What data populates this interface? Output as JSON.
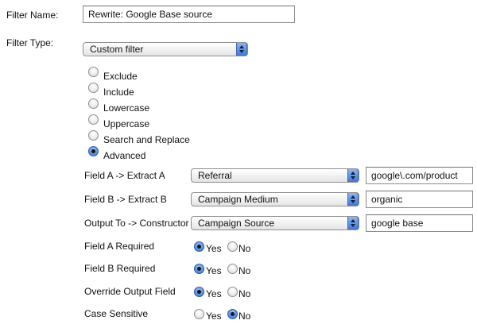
{
  "filter_name": {
    "label": "Filter Name:",
    "value": "Rewrite: Google Base source"
  },
  "filter_type": {
    "label": "Filter Type:",
    "selected": "Custom filter",
    "options": [
      {
        "label": "Exclude",
        "checked": false
      },
      {
        "label": "Include",
        "checked": false
      },
      {
        "label": "Lowercase",
        "checked": false
      },
      {
        "label": "Uppercase",
        "checked": false
      },
      {
        "label": "Search and Replace",
        "checked": false
      },
      {
        "label": "Advanced",
        "checked": true
      }
    ]
  },
  "fields": [
    {
      "label": "Field A -> Extract A",
      "select": "Referral",
      "value": "google\\.com/product"
    },
    {
      "label": "Field B -> Extract B",
      "select": "Campaign Medium",
      "value": "organic"
    },
    {
      "label": "Output To -> Constructor",
      "select": "Campaign Source",
      "value": "google base"
    }
  ],
  "yes_label": "Yes",
  "no_label": "No",
  "options": [
    {
      "label": "Field A Required",
      "value": "Yes"
    },
    {
      "label": "Field B Required",
      "value": "Yes"
    },
    {
      "label": "Override Output Field",
      "value": "Yes"
    },
    {
      "label": "Case Sensitive",
      "value": "No"
    }
  ],
  "colors": {
    "radio_selected": "#3a6fc4",
    "select_arrow": "#3f78d4"
  }
}
